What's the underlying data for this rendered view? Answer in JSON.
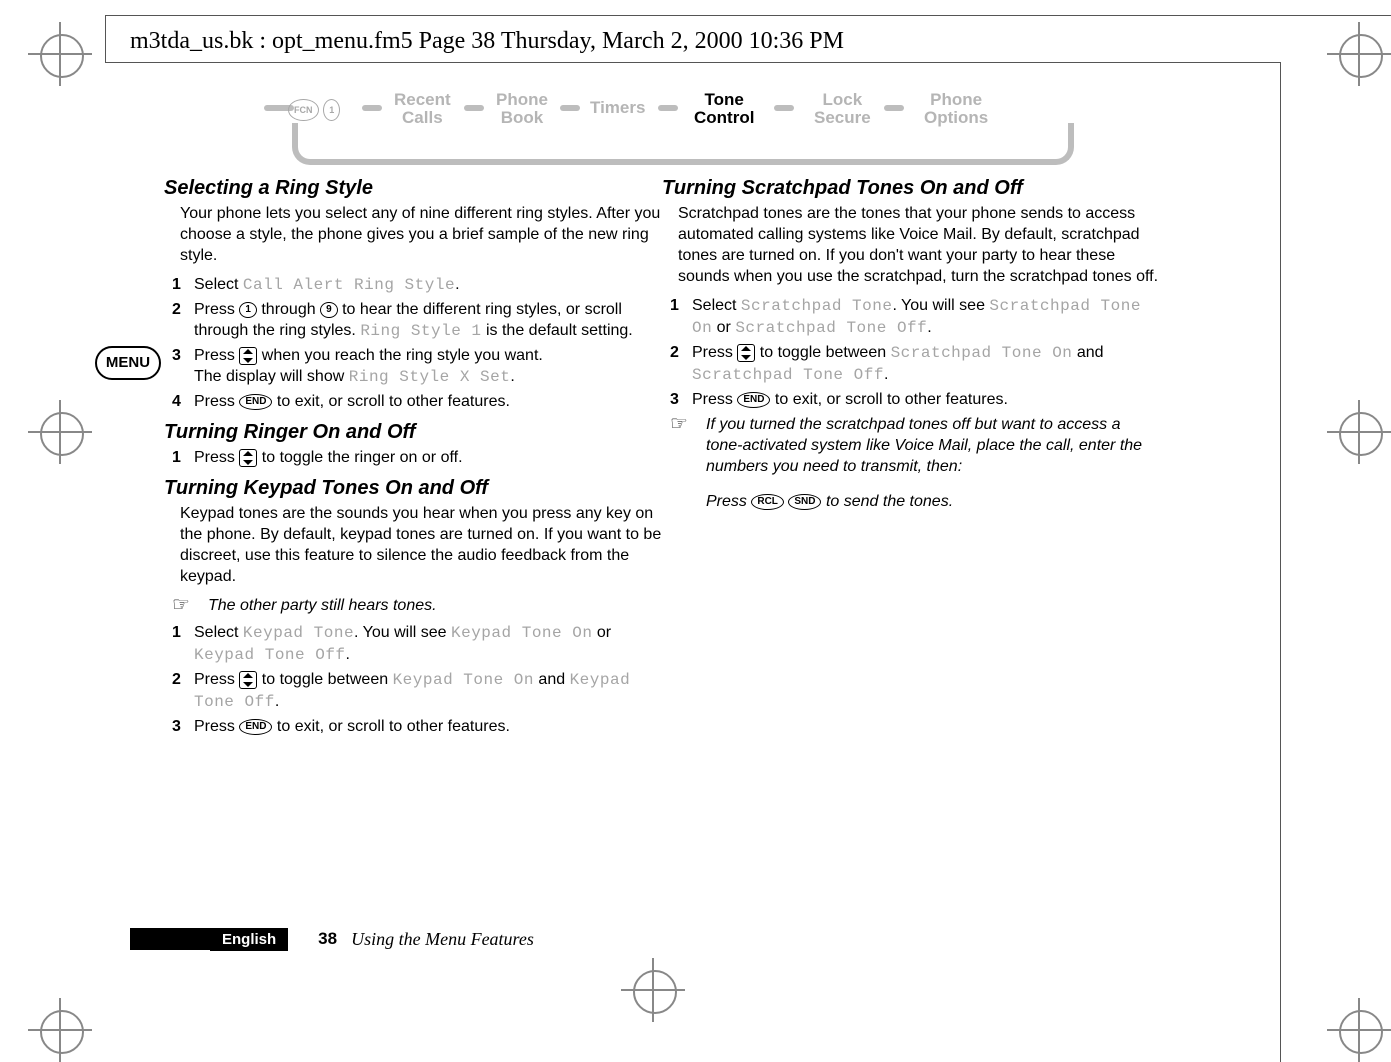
{
  "header": {
    "running_head": "m3tda_us.bk : opt_menu.fm5  Page 38  Thursday, March 2, 2000  10:36 PM"
  },
  "nav": {
    "fcn_label": "FCN",
    "key1_label": "1",
    "items": {
      "recent_calls": "Recent\nCalls",
      "phone_book": "Phone\nBook",
      "timers": "Timers",
      "tone_control": "Tone\nControl",
      "lock_secure": "Lock\nSecure",
      "phone_options": "Phone\nOptions"
    }
  },
  "menu_badge": "MENU",
  "keys": {
    "k1": "1",
    "k9": "9",
    "end": "END",
    "rcl": "RCL",
    "snd": "SND"
  },
  "left": {
    "h_ringstyle": "Selecting a Ring Style",
    "p_ringstyle": "Your phone lets you select any of nine different ring styles. After you choose a style, the phone gives you a brief sample of the new ring style.",
    "rs1_a": "Select ",
    "rs1_lcd": "Call Alert Ring Style",
    "rs1_b": ".",
    "rs2_a": "Press ",
    "rs2_b": " through ",
    "rs2_c": " to hear the different ring styles, or scroll through the ring styles. ",
    "rs2_lcd": "Ring Style 1",
    "rs2_d": " is the default setting.",
    "rs3_a": "Press ",
    "rs3_b": " when you reach the ring style you want.",
    "rs3_c": "The display will show ",
    "rs3_lcd": "Ring Style X Set",
    "rs3_d": ".",
    "rs4_a": "Press ",
    "rs4_b": " to exit, or scroll to other features.",
    "h_ringer": "Turning Ringer On and Off",
    "rg1_a": "Press ",
    "rg1_b": " to toggle the ringer on or off.",
    "h_keypad": "Turning Keypad Tones On and Off",
    "p_keypad": "Keypad tones are the sounds you hear when you press any key on the phone. By default, keypad tones are turned on. If you want to be discreet, use this feature to silence the audio feedback from the keypad.",
    "note_keypad": "The other party still hears tones.",
    "kp1_a": "Select ",
    "kp1_lcd1": "Keypad Tone",
    "kp1_b": ". You will see ",
    "kp1_lcd2": "Keypad Tone On",
    "kp1_c": " or ",
    "kp1_lcd3": "Keypad Tone Off",
    "kp1_d": ".",
    "kp2_a": "Press ",
    "kp2_b": " to toggle between ",
    "kp2_lcd1": "Keypad Tone On",
    "kp2_c": " and ",
    "kp2_lcd2": "Keypad Tone Off",
    "kp2_d": ".",
    "kp3_a": "Press ",
    "kp3_b": " to exit, or scroll to other features."
  },
  "right": {
    "h_scratch": "Turning Scratchpad Tones On and Off",
    "p_scratch": "Scratchpad tones are the tones that your phone sends to access automated calling systems like Voice Mail. By default, scratchpad tones are turned on. If you don't want your party to hear these sounds when you use the scratchpad, turn the scratchpad tones off.",
    "sp1_a": "Select ",
    "sp1_lcd1": "Scratchpad Tone",
    "sp1_b": ". You will see ",
    "sp1_lcd2": "Scratchpad Tone On",
    "sp1_c": " or ",
    "sp1_lcd3": "Scratchpad Tone Off",
    "sp1_d": ".",
    "sp2_a": "Press ",
    "sp2_b": " to toggle between ",
    "sp2_lcd1": "Scratchpad Tone On",
    "sp2_c": " and ",
    "sp2_lcd2": "Scratchpad Tone Off",
    "sp2_d": ".",
    "sp3_a": "Press ",
    "sp3_b": " to exit, or scroll to other features.",
    "note1": "If you turned the scratchpad tones off but want to access a tone-activated system like Voice Mail, place the call, enter the numbers you need to transmit, then:",
    "note2_a": "Press ",
    "note2_b": " to send the tones."
  },
  "footer": {
    "language": "English",
    "page_number": "38",
    "chapter": "Using the Menu Features"
  }
}
